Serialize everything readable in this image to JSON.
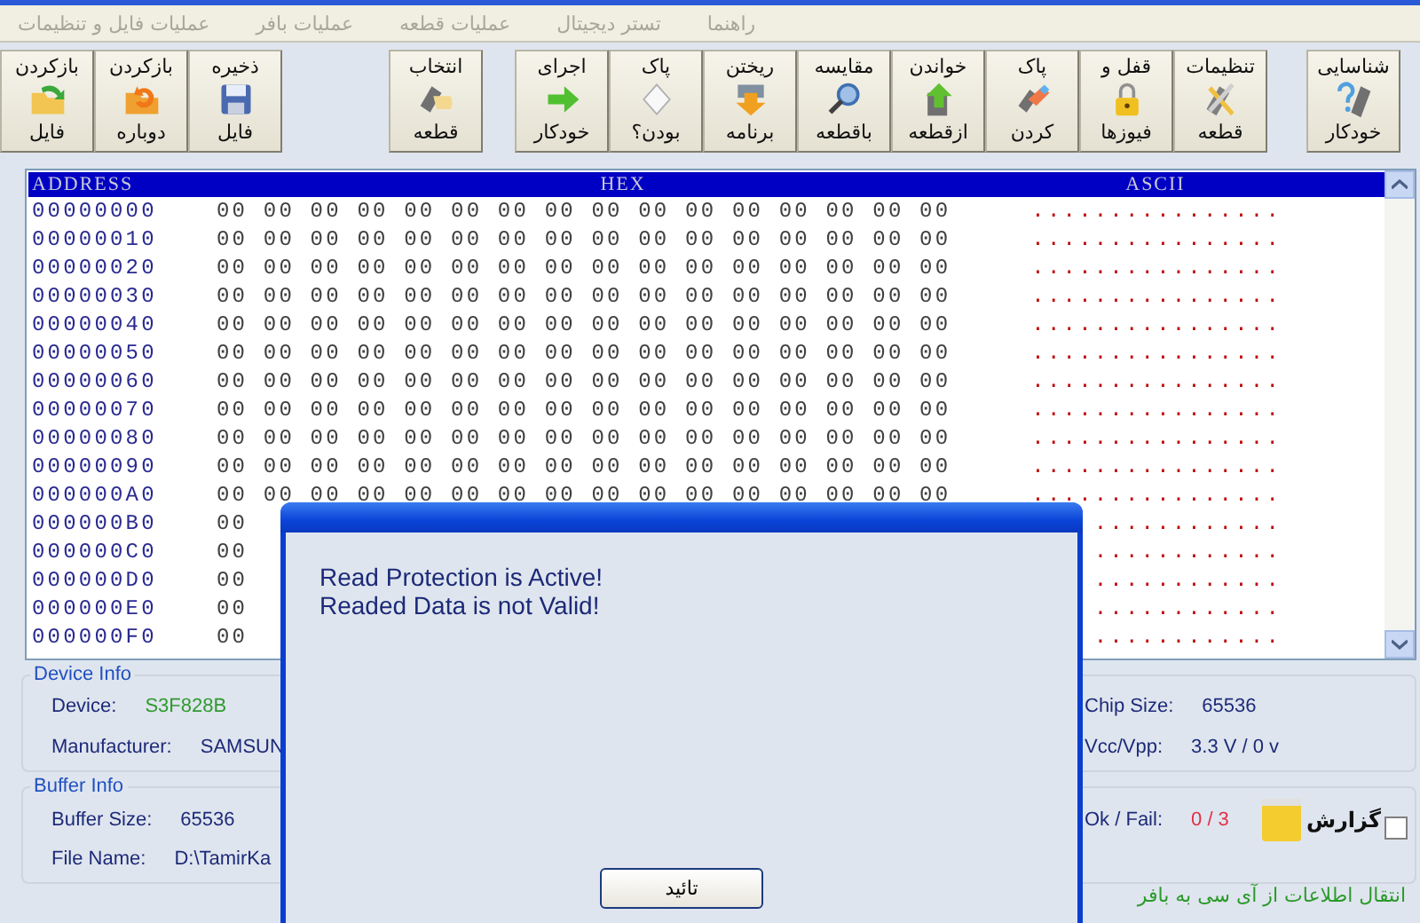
{
  "menu": [
    {
      "label": "راهنما",
      "disabled": true
    },
    {
      "label": "تستر دیجیتال",
      "disabled": true
    },
    {
      "label": "عملیات قطعه",
      "disabled": true
    },
    {
      "label": "عملیات بافر",
      "disabled": true
    },
    {
      "label": "عملیات فایل و تنظیمات",
      "disabled": true
    }
  ],
  "toolbar": {
    "groups": [
      [
        {
          "top": "شناسایی",
          "bottom": "خودکار"
        }
      ],
      [
        {
          "top": "تنظیمات",
          "bottom": "قطعه"
        },
        {
          "top": "قفل و",
          "bottom": "فیوزها"
        },
        {
          "top": "پاک",
          "bottom": "کردن"
        },
        {
          "top": "خواندن",
          "bottom": "ازقطعه"
        },
        {
          "top": "مقایسه",
          "bottom": "باقطعه"
        },
        {
          "top": "ریختن",
          "bottom": "برنامه"
        },
        {
          "top": "پاک",
          "bottom": "بودن؟"
        },
        {
          "top": "اجرای",
          "bottom": "خودکار"
        }
      ],
      [
        {
          "top": "انتخاب",
          "bottom": "قطعه"
        }
      ],
      [
        {
          "top": "ذخیره",
          "bottom": "فایل"
        },
        {
          "top": "بازکردن",
          "bottom": "دوباره"
        },
        {
          "top": "بازکردن",
          "bottom": "فایل"
        }
      ]
    ]
  },
  "hex_view": {
    "headers": {
      "address": "ADDRESS",
      "hex": "HEX",
      "ascii": "ASCII"
    },
    "rows": [
      {
        "address": "00000000",
        "hex": "00 00 00 00 00 00 00 00 00 00 00 00 00 00 00 00",
        "ascii": "................"
      },
      {
        "address": "00000010",
        "hex": "00 00 00 00 00 00 00 00 00 00 00 00 00 00 00 00",
        "ascii": "................"
      },
      {
        "address": "00000020",
        "hex": "00 00 00 00 00 00 00 00 00 00 00 00 00 00 00 00",
        "ascii": "................"
      },
      {
        "address": "00000030",
        "hex": "00 00 00 00 00 00 00 00 00 00 00 00 00 00 00 00",
        "ascii": "................"
      },
      {
        "address": "00000040",
        "hex": "00 00 00 00 00 00 00 00 00 00 00 00 00 00 00 00",
        "ascii": "................"
      },
      {
        "address": "00000050",
        "hex": "00 00 00 00 00 00 00 00 00 00 00 00 00 00 00 00",
        "ascii": "................"
      },
      {
        "address": "00000060",
        "hex": "00 00 00 00 00 00 00 00 00 00 00 00 00 00 00 00",
        "ascii": "................"
      },
      {
        "address": "00000070",
        "hex": "00 00 00 00 00 00 00 00 00 00 00 00 00 00 00 00",
        "ascii": "................"
      },
      {
        "address": "00000080",
        "hex": "00 00 00 00 00 00 00 00 00 00 00 00 00 00 00 00",
        "ascii": "................"
      },
      {
        "address": "00000090",
        "hex": "00 00 00 00 00 00 00 00 00 00 00 00 00 00 00 00",
        "ascii": "................"
      },
      {
        "address": "000000A0",
        "hex": "00 00 00 00 00 00 00 00 00 00 00 00 00 00 00 00",
        "ascii": "................"
      },
      {
        "address": "000000B0",
        "hex": "00",
        "ascii": "............"
      },
      {
        "address": "000000C0",
        "hex": "00",
        "ascii": "............"
      },
      {
        "address": "000000D0",
        "hex": "00",
        "ascii": "............"
      },
      {
        "address": "000000E0",
        "hex": "00",
        "ascii": "............"
      },
      {
        "address": "000000F0",
        "hex": "00",
        "ascii": "............"
      }
    ]
  },
  "device_info": {
    "title": "Device Info",
    "rows": [
      {
        "left": {
          "label": "Device:",
          "value": "S3F828B",
          "color": "#2e9a2e"
        },
        "right": {
          "label": "Chip Size:",
          "value": "65536",
          "color": "#1c2a78"
        }
      },
      {
        "left": {
          "label": "Manufacturer:",
          "value": "SAMSUN",
          "color": "#1c2a78"
        },
        "right": {
          "label": "Vcc/Vpp:",
          "value": "3.3 V / 0 v",
          "color": "#1c2a78"
        }
      }
    ]
  },
  "buffer_info": {
    "title": "Buffer Info",
    "rows": [
      {
        "left": {
          "label": "Buffer Size:",
          "value": "65536",
          "color": "#1c2a78"
        },
        "right": {
          "label": "Ok / Fail:",
          "value": "0 / 3",
          "color": "#e03048"
        }
      },
      {
        "left": {
          "label": "File Name:",
          "value": "D:\\TamirKa",
          "color": "#1c2a78"
        }
      }
    ],
    "report": {
      "label": "گزارش",
      "checked": false
    }
  },
  "status": "انتقال اطلاعات از  آی سی به بافر",
  "dialog": {
    "message": [
      "Read Protection is Active!",
      "Readed Data is not Valid!"
    ],
    "button": "تائید"
  }
}
